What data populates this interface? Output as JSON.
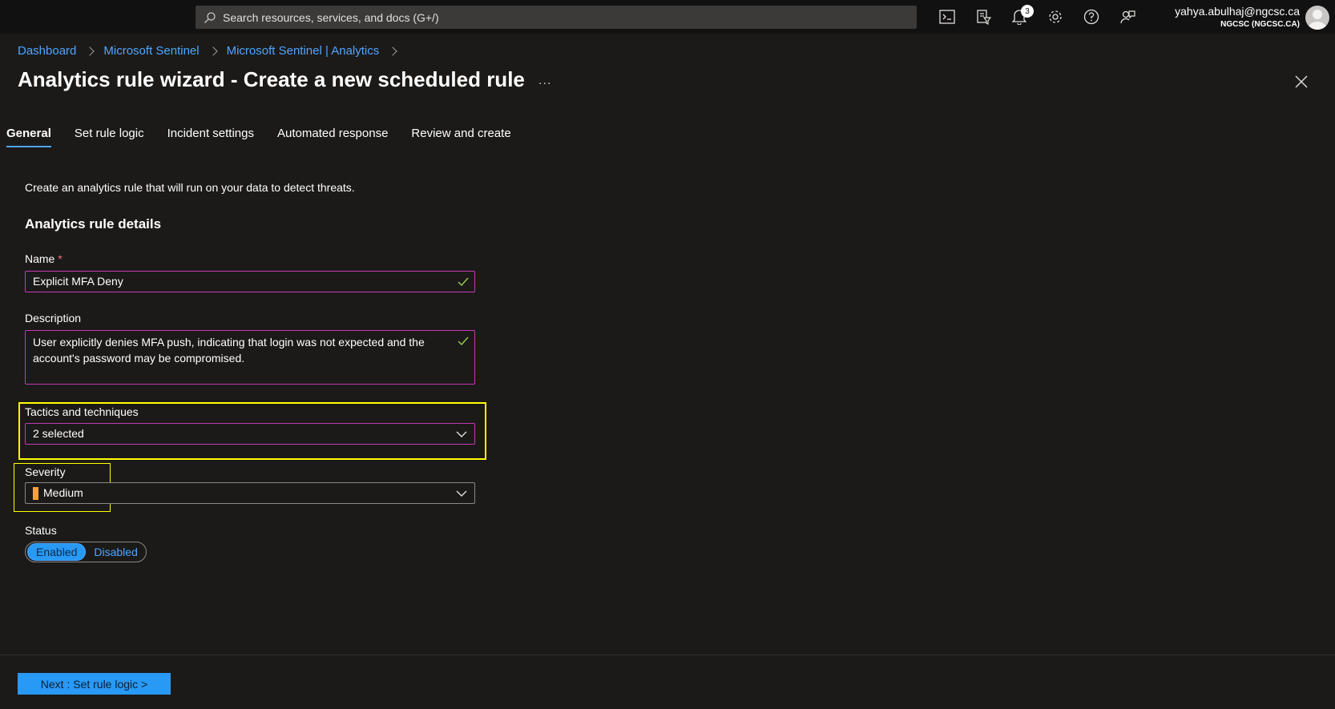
{
  "topbar": {
    "search_placeholder": "Search resources, services, and docs (G+/)",
    "notification_count": "3",
    "account_email": "yahya.abulhaj@ngcsc.ca",
    "account_tenant": "NGCSC (NGCSC.CA)",
    "icons": [
      "cloud-shell-icon",
      "directory-filter-icon",
      "bell-icon",
      "gear-icon",
      "help-icon",
      "feedback-icon"
    ]
  },
  "breadcrumb": [
    "Dashboard",
    "Microsoft Sentinel",
    "Microsoft Sentinel | Analytics"
  ],
  "page": {
    "title": "Analytics rule wizard - Create a new scheduled rule",
    "more": "...",
    "tabs": [
      "General",
      "Set rule logic",
      "Incident settings",
      "Automated response",
      "Review and create"
    ],
    "active_tab": "General"
  },
  "form": {
    "intro": "Create an analytics rule that will run on your data to detect threats.",
    "section_title": "Analytics rule details",
    "name_label": "Name",
    "required_mark": "*",
    "name_value": "Explicit MFA Deny",
    "description_label": "Description",
    "description_value": "User explicitly denies MFA push, indicating that login was not expected and the account's password may be compromised.",
    "tactics_label": "Tactics and techniques",
    "tactics_value": "2 selected",
    "severity_label": "Severity",
    "severity_value": "Medium",
    "status_label": "Status",
    "status_options": [
      "Enabled",
      "Disabled"
    ],
    "status_selected": "Enabled"
  },
  "footer": {
    "next_label": "Next : Set rule logic >"
  },
  "colors": {
    "accent": "#2899f5",
    "link": "#4fa5ff",
    "field_border": "#c239b3",
    "highlight": "#ffff00",
    "severity_medium": "#f7a233"
  }
}
